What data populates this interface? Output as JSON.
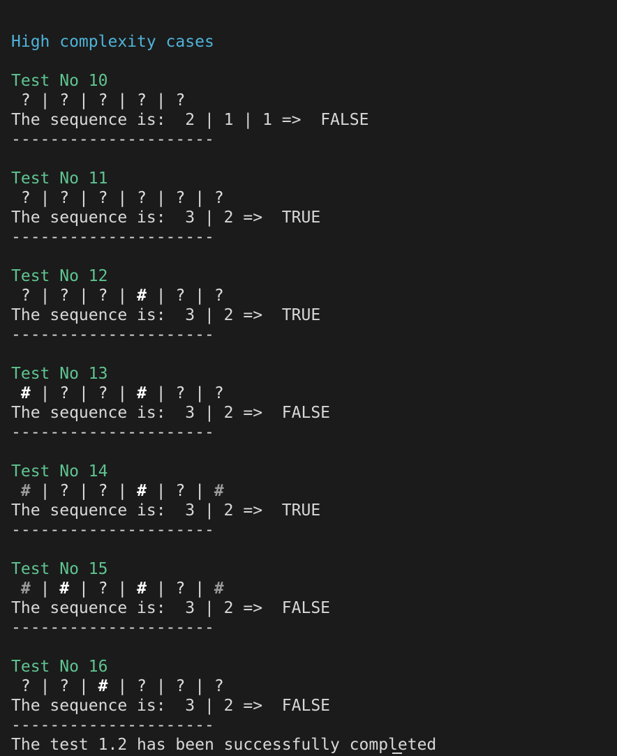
{
  "heading": "High complexity cases",
  "separator": "---------------------",
  "sequence_label": "The sequence is:",
  "tests": [
    {
      "title": "Test No 10",
      "cells": [
        "?",
        "?",
        "?",
        "?",
        "?"
      ],
      "sequence": [
        "2",
        "1",
        "1"
      ],
      "result": "FALSE"
    },
    {
      "title": "Test No 11",
      "cells": [
        "?",
        "?",
        "?",
        "?",
        "?",
        "?"
      ],
      "sequence": [
        "3",
        "2"
      ],
      "result": "TRUE"
    },
    {
      "title": "Test No 12",
      "cells": [
        "?",
        "?",
        "?",
        "#",
        "?",
        "?"
      ],
      "sequence": [
        "3",
        "2"
      ],
      "result": "TRUE"
    },
    {
      "title": "Test No 13",
      "cells": [
        "#",
        "?",
        "?",
        "#",
        "?",
        "?"
      ],
      "sequence": [
        "3",
        "2"
      ],
      "result": "FALSE"
    },
    {
      "title": "Test No 14",
      "cells": [
        "#",
        "?",
        "?",
        "#",
        "?",
        "#"
      ],
      "dim_cells": [
        0,
        5
      ],
      "sequence": [
        "3",
        "2"
      ],
      "result": "TRUE"
    },
    {
      "title": "Test No 15",
      "cells": [
        "#",
        "#",
        "?",
        "#",
        "?",
        "#"
      ],
      "dim_cells": [
        0,
        5
      ],
      "sequence": [
        "3",
        "2"
      ],
      "result": "FALSE"
    },
    {
      "title": "Test No 16",
      "cells": [
        "?",
        "?",
        "#",
        "?",
        "?",
        "?"
      ],
      "sequence": [
        "3",
        "2"
      ],
      "result": "FALSE"
    }
  ],
  "footer": "The test 1.2 has been successfully completed",
  "colors": {
    "background": "#1b1b1b",
    "heading": "#4fb3d9",
    "test_title": "#5fc490",
    "text": "#d8d8d8"
  }
}
